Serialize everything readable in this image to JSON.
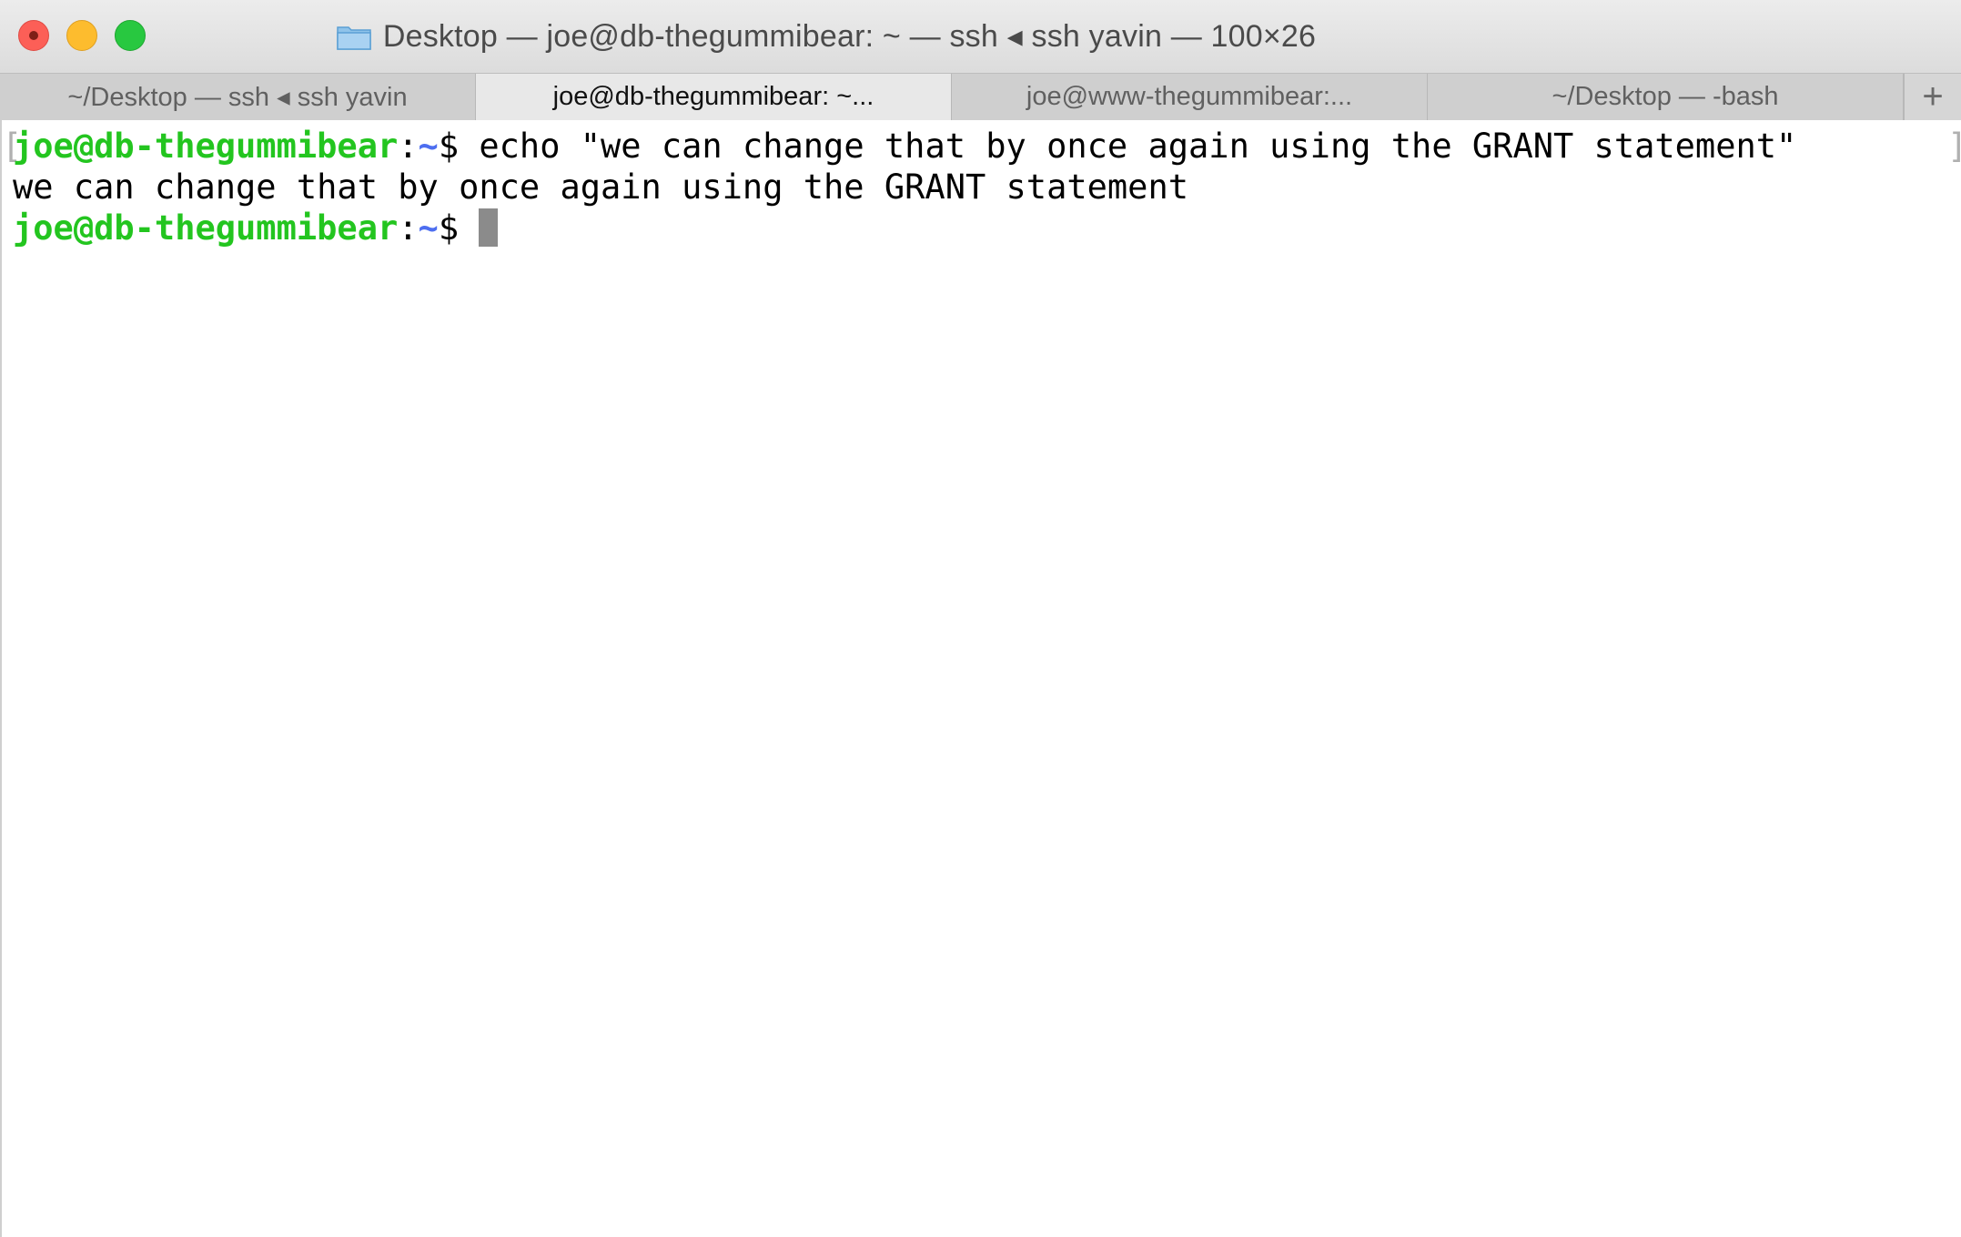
{
  "window": {
    "title": "Desktop — joe@db-thegummibear: ~ — ssh ◂ ssh yavin — 100×26",
    "colors": {
      "close": "#fc5f57",
      "minimize": "#fdbc2e",
      "maximize": "#28c840"
    }
  },
  "tabs": [
    {
      "label": "~/Desktop — ssh ◂ ssh yavin",
      "active": false
    },
    {
      "label": "joe@db-thegummibear: ~...",
      "active": true
    },
    {
      "label": "joe@www-thegummibear:...",
      "active": false
    },
    {
      "label": "~/Desktop — -bash",
      "active": false
    }
  ],
  "tab_add_label": "+",
  "terminal": {
    "prompt_user": "joe@db-thegummibear",
    "prompt_colon": ":",
    "prompt_path": "~",
    "prompt_symbol": "$",
    "line1_command": " echo \"we can change that by once again using the GRANT statement\"",
    "line2_output": "we can change that by once again using the GRANT statement",
    "bracket_left": "[",
    "bracket_right": "]",
    "colors": {
      "user": "#23c51f",
      "path": "#4d6ef0",
      "cursor": "#8b8b8b"
    }
  }
}
